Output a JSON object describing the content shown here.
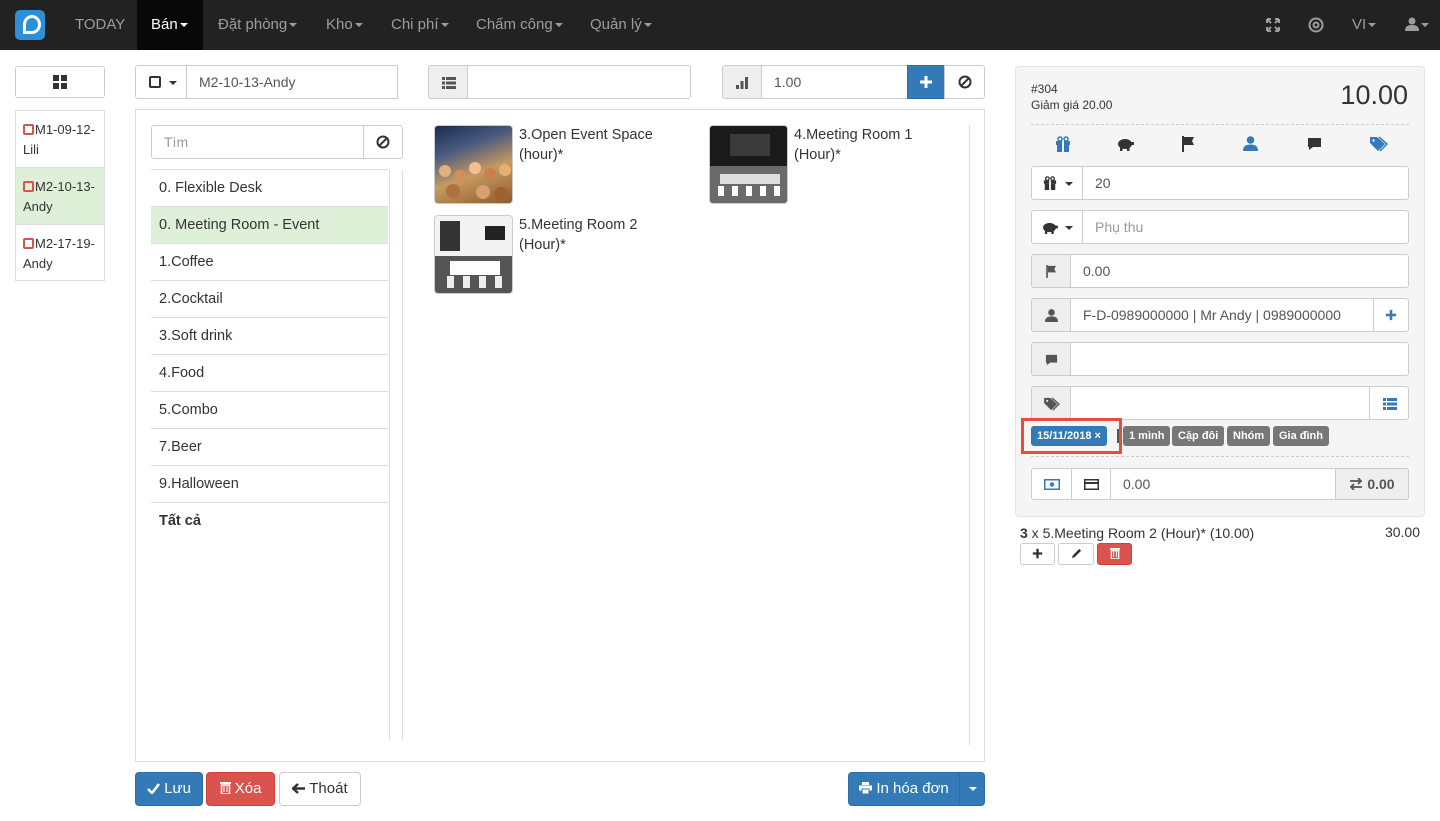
{
  "nav": {
    "today": "TODAY",
    "ban": "Bán",
    "dat_phong": "Đặt phòng",
    "kho": "Kho",
    "chi_phi": "Chi phí",
    "cham_cong": "Chấm công",
    "quan_ly": "Quản lý",
    "lang": "VI"
  },
  "tables": [
    {
      "label": "M1-09-12-Lili"
    },
    {
      "label": "M2-10-13-Andy"
    },
    {
      "label": "M2-17-19-Andy"
    }
  ],
  "toolbar": {
    "table_name": "M2-10-13-Andy",
    "quantity": "1.00"
  },
  "search": {
    "placeholder": "Tìm"
  },
  "categories": [
    "0. Flexible Desk",
    "0. Meeting Room - Event",
    "1.Coffee",
    "2.Cocktail",
    "3.Soft drink",
    "4.Food",
    "5.Combo",
    "7.Beer",
    "9.Halloween",
    "Tất cả"
  ],
  "products": [
    {
      "name": "3.Open Event Space (hour)*"
    },
    {
      "name": "4.Meeting Room 1 (Hour)*"
    },
    {
      "name": "5.Meeting Room 2 (Hour)*"
    }
  ],
  "order": {
    "number": "#304",
    "discount_label": "Giảm giá 20.00",
    "total": "10.00",
    "discount_value": "20",
    "surcharge_placeholder": "Phụ thu",
    "flag_value": "0.00",
    "customer": "F-D-0989000000 | Mr Andy | 0989000000",
    "paid": "0.00",
    "change": "0.00"
  },
  "tags": {
    "date": "15/11/2018 ×",
    "t1": "1 mình",
    "t2": "Cặp đôi",
    "t3": "Nhóm",
    "t4": "Gia đình"
  },
  "line": {
    "qty": "3",
    "desc": " x 5.Meeting Room 2 (Hour)* (10.00)",
    "amount": "30.00"
  },
  "buttons": {
    "save": "Lưu",
    "delete": "Xóa",
    "exit": "Thoát",
    "print": "In hóa đơn"
  },
  "colors": {
    "primary": "#337ab7",
    "danger": "#d9534f",
    "highlight": "#e74c3c"
  }
}
